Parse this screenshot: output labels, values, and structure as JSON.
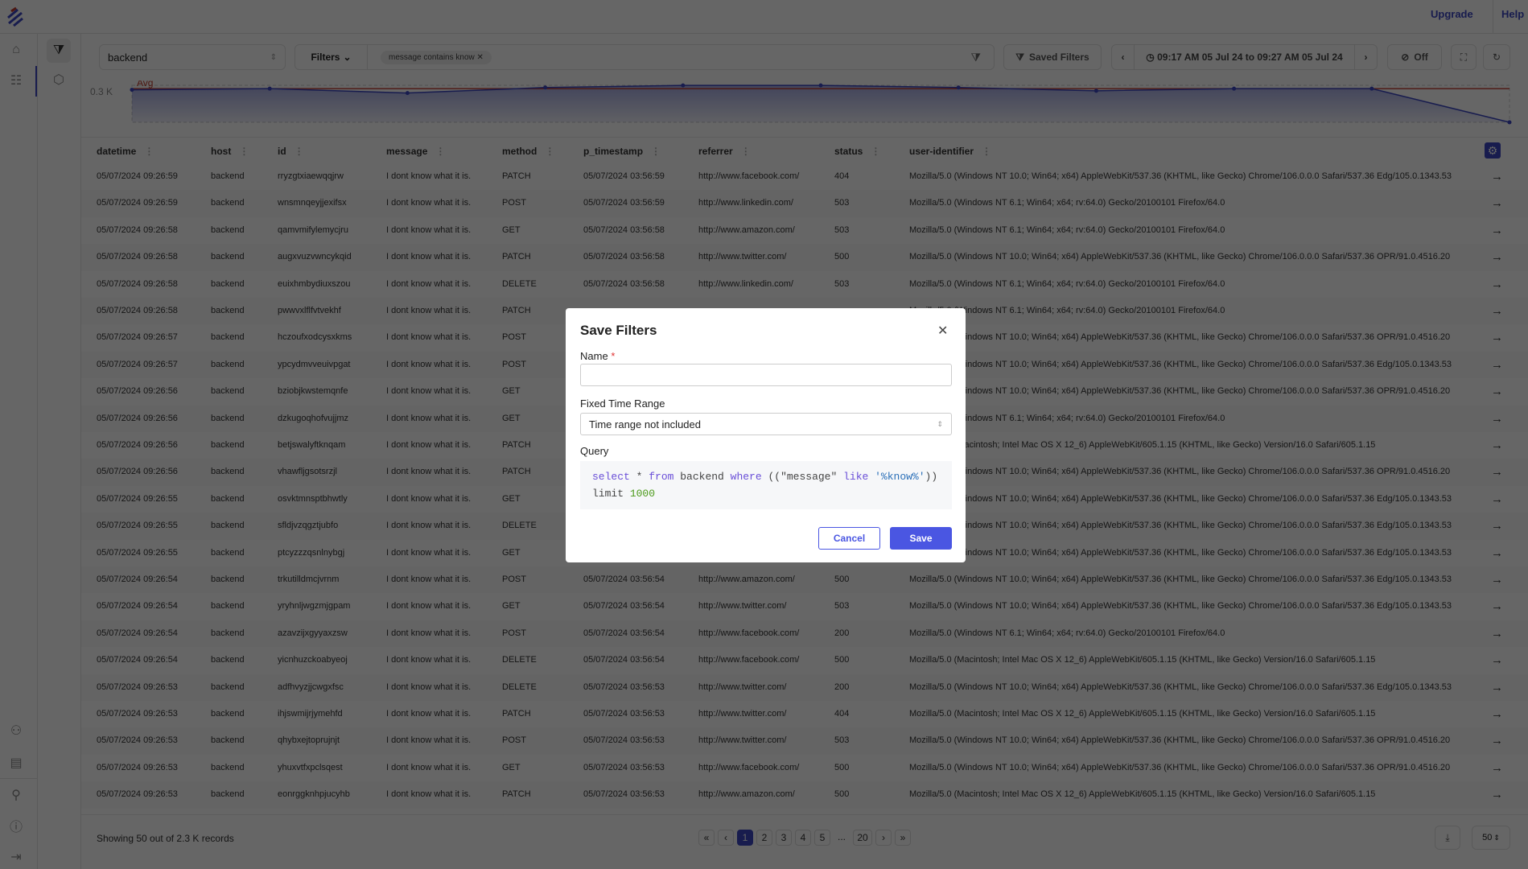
{
  "topbar": {
    "upgrade": "Upgrade",
    "help": "Help"
  },
  "colors": {
    "accent": "#4a56e2",
    "avg_line": "#c0392b",
    "series": "#3b47c4"
  },
  "sidebar": {
    "items": [
      "home-icon",
      "logs-list-icon"
    ],
    "bottom_items": [
      "user-settings-icon",
      "storage-settings-icon",
      "user-icon",
      "info-icon",
      "logout-icon"
    ]
  },
  "subbar": {
    "items": [
      "filter-search-icon",
      "hexagon-settings-icon"
    ]
  },
  "toolbar": {
    "stream": "backend",
    "filters_label": "Filters",
    "filter_chip": "message contains know",
    "saved_filters": "Saved Filters",
    "time_range": "09:17 AM 05 Jul 24 to 09:27 AM 05 Jul 24",
    "refresh_interval": "Off"
  },
  "chart": {
    "type": "area",
    "y_tick": "0.3 K",
    "avg_label": "Avg",
    "avg_value": 300,
    "values": [
      290,
      300,
      261,
      310,
      329,
      329,
      310,
      281,
      300,
      300,
      0
    ],
    "ylim": [
      0,
      330
    ]
  },
  "table": {
    "columns": [
      "datetime",
      "host",
      "id",
      "message",
      "method",
      "p_timestamp",
      "referrer",
      "status",
      "user-identifier"
    ],
    "rows": [
      [
        "05/07/2024 09:26:59",
        "backend",
        "rryzgtxiaewqqjrw",
        "I dont know what it is.",
        "PATCH",
        "05/07/2024 03:56:59",
        "http://www.facebook.com/",
        "404",
        "Mozilla/5.0 (Windows NT 10.0; Win64; x64) AppleWebKit/537.36 (KHTML, like Gecko) Chrome/106.0.0.0 Safari/537.36 Edg/105.0.1343.53"
      ],
      [
        "05/07/2024 09:26:59",
        "backend",
        "wnsmnqeyjjexifsx",
        "I dont know what it is.",
        "POST",
        "05/07/2024 03:56:59",
        "http://www.linkedin.com/",
        "503",
        "Mozilla/5.0 (Windows NT 6.1; Win64; x64; rv:64.0) Gecko/20100101 Firefox/64.0"
      ],
      [
        "05/07/2024 09:26:58",
        "backend",
        "qamvmifylemycjru",
        "I dont know what it is.",
        "GET",
        "05/07/2024 03:56:58",
        "http://www.amazon.com/",
        "503",
        "Mozilla/5.0 (Windows NT 6.1; Win64; x64; rv:64.0) Gecko/20100101 Firefox/64.0"
      ],
      [
        "05/07/2024 09:26:58",
        "backend",
        "augxvuzvwncykqid",
        "I dont know what it is.",
        "PATCH",
        "05/07/2024 03:56:58",
        "http://www.twitter.com/",
        "500",
        "Mozilla/5.0 (Windows NT 10.0; Win64; x64) AppleWebKit/537.36 (KHTML, like Gecko) Chrome/106.0.0.0 Safari/537.36 OPR/91.0.4516.20"
      ],
      [
        "05/07/2024 09:26:58",
        "backend",
        "euixhmbydiuxszou",
        "I dont know what it is.",
        "DELETE",
        "05/07/2024 03:56:58",
        "http://www.linkedin.com/",
        "503",
        "Mozilla/5.0 (Windows NT 6.1; Win64; x64; rv:64.0) Gecko/20100101 Firefox/64.0"
      ],
      [
        "05/07/2024 09:26:58",
        "backend",
        "pwwvxlflfvtvekhf",
        "I dont know what it is.",
        "PATCH",
        "",
        "",
        "",
        "Mozilla/5.0 (Windows NT 6.1; Win64; x64; rv:64.0) Gecko/20100101 Firefox/64.0"
      ],
      [
        "05/07/2024 09:26:57",
        "backend",
        "hczoufxodcysxkms",
        "I dont know what it is.",
        "POST",
        "",
        "",
        "",
        "Mozilla/5.0 (Windows NT 10.0; Win64; x64) AppleWebKit/537.36 (KHTML, like Gecko) Chrome/106.0.0.0 Safari/537.36 OPR/91.0.4516.20"
      ],
      [
        "05/07/2024 09:26:57",
        "backend",
        "ypcydmvveuivpgat",
        "I dont know what it is.",
        "POST",
        "",
        "",
        "",
        "Mozilla/5.0 (Windows NT 10.0; Win64; x64) AppleWebKit/537.36 (KHTML, like Gecko) Chrome/106.0.0.0 Safari/537.36 Edg/105.0.1343.53"
      ],
      [
        "05/07/2024 09:26:56",
        "backend",
        "bziobjkwstemqnfe",
        "I dont know what it is.",
        "GET",
        "",
        "",
        "",
        "Mozilla/5.0 (Windows NT 10.0; Win64; x64) AppleWebKit/537.36 (KHTML, like Gecko) Chrome/106.0.0.0 Safari/537.36 OPR/91.0.4516.20"
      ],
      [
        "05/07/2024 09:26:56",
        "backend",
        "dzkugoqhofvujjmz",
        "I dont know what it is.",
        "GET",
        "",
        "",
        "",
        "Mozilla/5.0 (Windows NT 6.1; Win64; x64; rv:64.0) Gecko/20100101 Firefox/64.0"
      ],
      [
        "05/07/2024 09:26:56",
        "backend",
        "betjswalyftknqam",
        "I dont know what it is.",
        "PATCH",
        "",
        "",
        "",
        "Mozilla/5.0 (Macintosh; Intel Mac OS X 12_6) AppleWebKit/605.1.15 (KHTML, like Gecko) Version/16.0 Safari/605.1.15"
      ],
      [
        "05/07/2024 09:26:56",
        "backend",
        "vhawfljgsotsrzjl",
        "I dont know what it is.",
        "PATCH",
        "",
        "",
        "",
        "Mozilla/5.0 (Windows NT 10.0; Win64; x64) AppleWebKit/537.36 (KHTML, like Gecko) Chrome/106.0.0.0 Safari/537.36 OPR/91.0.4516.20"
      ],
      [
        "05/07/2024 09:26:55",
        "backend",
        "osvktmnsptbhwtly",
        "I dont know what it is.",
        "GET",
        "",
        "",
        "",
        "Mozilla/5.0 (Windows NT 10.0; Win64; x64) AppleWebKit/537.36 (KHTML, like Gecko) Chrome/106.0.0.0 Safari/537.36 Edg/105.0.1343.53"
      ],
      [
        "05/07/2024 09:26:55",
        "backend",
        "sfldjvzqgztjubfo",
        "I dont know what it is.",
        "DELETE",
        "",
        "",
        "",
        "Mozilla/5.0 (Windows NT 10.0; Win64; x64) AppleWebKit/537.36 (KHTML, like Gecko) Chrome/106.0.0.0 Safari/537.36 Edg/105.0.1343.53"
      ],
      [
        "05/07/2024 09:26:55",
        "backend",
        "ptcyzzzqsnlnybgj",
        "I dont know what it is.",
        "GET",
        "",
        "",
        "",
        "Mozilla/5.0 (Windows NT 10.0; Win64; x64) AppleWebKit/537.36 (KHTML, like Gecko) Chrome/106.0.0.0 Safari/537.36 Edg/105.0.1343.53"
      ],
      [
        "05/07/2024 09:26:54",
        "backend",
        "trkutilldmcjvrnm",
        "I dont know what it is.",
        "POST",
        "05/07/2024 03:56:54",
        "http://www.amazon.com/",
        "500",
        "Mozilla/5.0 (Windows NT 10.0; Win64; x64) AppleWebKit/537.36 (KHTML, like Gecko) Chrome/106.0.0.0 Safari/537.36 Edg/105.0.1343.53"
      ],
      [
        "05/07/2024 09:26:54",
        "backend",
        "yryhnljwgzmjgpam",
        "I dont know what it is.",
        "GET",
        "05/07/2024 03:56:54",
        "http://www.twitter.com/",
        "503",
        "Mozilla/5.0 (Windows NT 10.0; Win64; x64) AppleWebKit/537.36 (KHTML, like Gecko) Chrome/106.0.0.0 Safari/537.36 Edg/105.0.1343.53"
      ],
      [
        "05/07/2024 09:26:54",
        "backend",
        "azavzijxgyyaxzsw",
        "I dont know what it is.",
        "POST",
        "05/07/2024 03:56:54",
        "http://www.facebook.com/",
        "200",
        "Mozilla/5.0 (Windows NT 6.1; Win64; x64; rv:64.0) Gecko/20100101 Firefox/64.0"
      ],
      [
        "05/07/2024 09:26:54",
        "backend",
        "yicnhuzckoabyeoj",
        "I dont know what it is.",
        "DELETE",
        "05/07/2024 03:56:54",
        "http://www.facebook.com/",
        "500",
        "Mozilla/5.0 (Macintosh; Intel Mac OS X 12_6) AppleWebKit/605.1.15 (KHTML, like Gecko) Version/16.0 Safari/605.1.15"
      ],
      [
        "05/07/2024 09:26:53",
        "backend",
        "adfhvyzjjcwgxfsc",
        "I dont know what it is.",
        "DELETE",
        "05/07/2024 03:56:53",
        "http://www.twitter.com/",
        "200",
        "Mozilla/5.0 (Windows NT 10.0; Win64; x64) AppleWebKit/537.36 (KHTML, like Gecko) Chrome/106.0.0.0 Safari/537.36 Edg/105.0.1343.53"
      ],
      [
        "05/07/2024 09:26:53",
        "backend",
        "ihjswmijrjymehfd",
        "I dont know what it is.",
        "PATCH",
        "05/07/2024 03:56:53",
        "http://www.twitter.com/",
        "404",
        "Mozilla/5.0 (Macintosh; Intel Mac OS X 12_6) AppleWebKit/605.1.15 (KHTML, like Gecko) Version/16.0 Safari/605.1.15"
      ],
      [
        "05/07/2024 09:26:53",
        "backend",
        "qhybxejtoprujnjt",
        "I dont know what it is.",
        "POST",
        "05/07/2024 03:56:53",
        "http://www.twitter.com/",
        "503",
        "Mozilla/5.0 (Windows NT 10.0; Win64; x64) AppleWebKit/537.36 (KHTML, like Gecko) Chrome/106.0.0.0 Safari/537.36 OPR/91.0.4516.20"
      ],
      [
        "05/07/2024 09:26:53",
        "backend",
        "yhuxvtfxpclsqest",
        "I dont know what it is.",
        "GET",
        "05/07/2024 03:56:53",
        "http://www.facebook.com/",
        "500",
        "Mozilla/5.0 (Windows NT 10.0; Win64; x64) AppleWebKit/537.36 (KHTML, like Gecko) Chrome/106.0.0.0 Safari/537.36 OPR/91.0.4516.20"
      ],
      [
        "05/07/2024 09:26:53",
        "backend",
        "eonrggknhpjucyhb",
        "I dont know what it is.",
        "PATCH",
        "05/07/2024 03:56:53",
        "http://www.amazon.com/",
        "500",
        "Mozilla/5.0 (Macintosh; Intel Mac OS X 12_6) AppleWebKit/605.1.15 (KHTML, like Gecko) Version/16.0 Safari/605.1.15"
      ]
    ]
  },
  "footer": {
    "showing": "Showing 50 out of 2.3 K records",
    "pages": [
      "1",
      "2",
      "3",
      "4",
      "5",
      "...",
      "20"
    ],
    "current_page": "1",
    "per_page": "50"
  },
  "modal": {
    "title": "Save Filters",
    "name_label": "Name",
    "required_mark": "*",
    "name_value": "",
    "time_range_label": "Fixed Time Range",
    "time_range_value": "Time range not included",
    "query_label": "Query",
    "query": {
      "select": "select",
      "star": " * ",
      "from": "from",
      "table": " backend ",
      "where": "where",
      "open": " ((\"message\" ",
      "like": "like",
      "pattern": " '%know%'",
      "close": "))",
      "limit": "limit ",
      "limit_value": "1000"
    },
    "cancel": "Cancel",
    "save": "Save"
  }
}
